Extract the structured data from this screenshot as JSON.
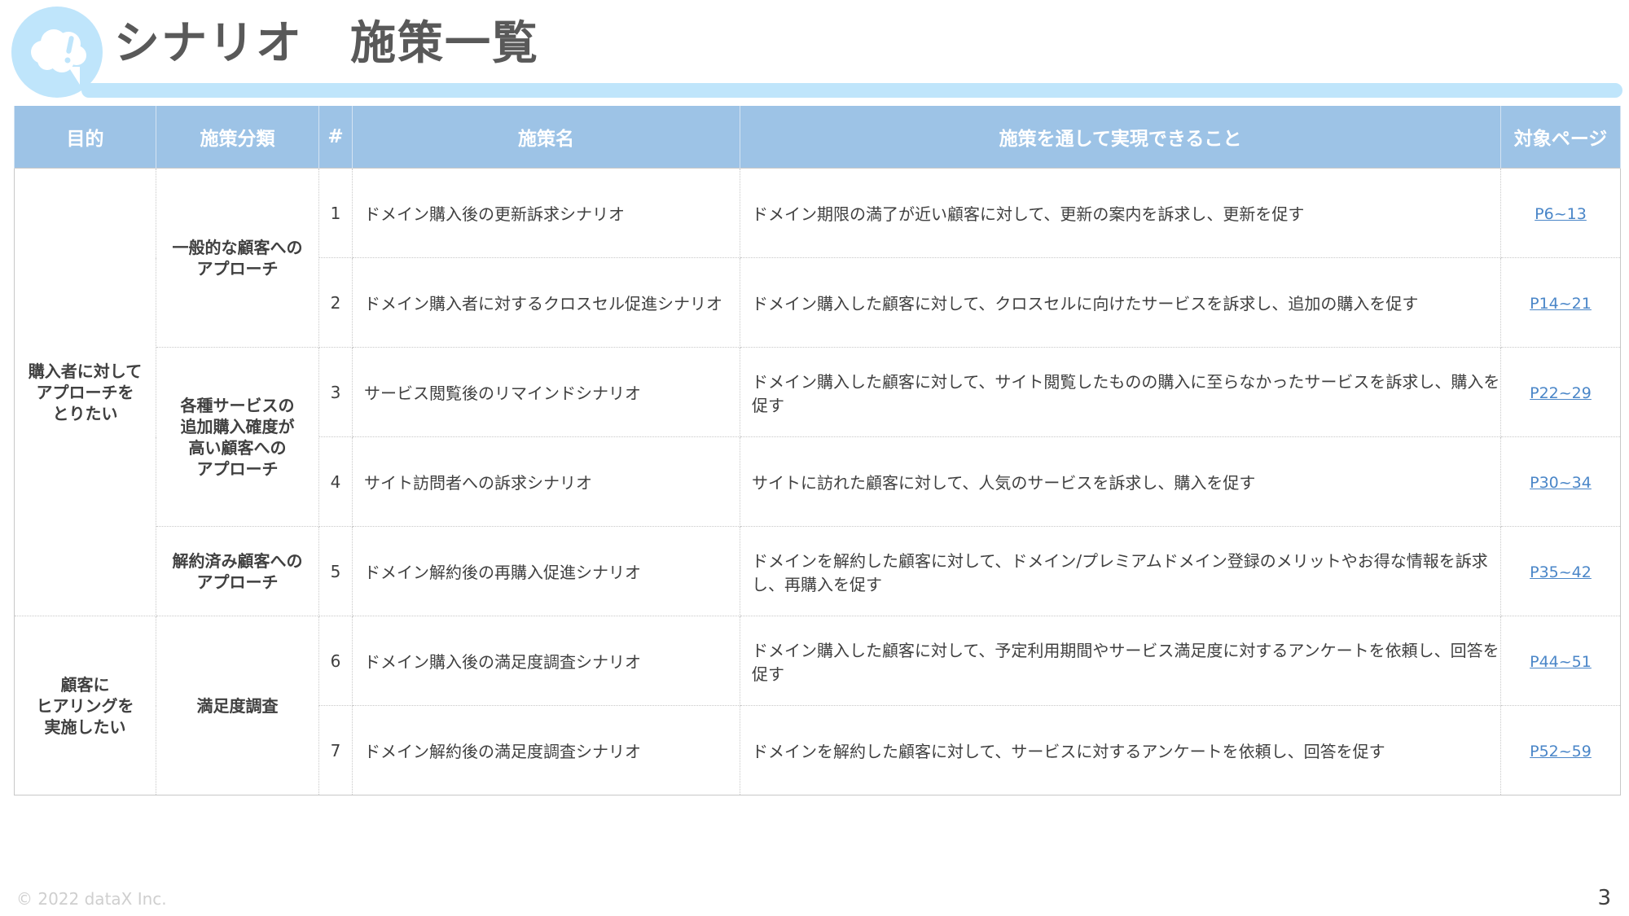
{
  "header": {
    "title": "シナリオ　施策一覧",
    "logo_icon": "thought-bubble-exclamation-icon",
    "accent_color": "#bfe5fb"
  },
  "table": {
    "header_color": "#9dc3e6",
    "link_color": "#4a86c8",
    "columns": [
      "目的",
      "施策分類",
      "#",
      "施策名",
      "施策を通して実現できること",
      "対象ページ"
    ],
    "purposes": [
      {
        "label": "購入者に対して\nアプローチを\nとりたい",
        "rows": 5
      },
      {
        "label": "顧客に\nヒアリングを\n実施したい",
        "rows": 2
      }
    ],
    "categories": [
      {
        "label": "一般的な顧客への\nアプローチ",
        "rows": 2
      },
      {
        "label": "各種サービスの\n追加購入確度が\n高い顧客への\nアプローチ",
        "rows": 2
      },
      {
        "label": "解約済み顧客への\nアプローチ",
        "rows": 1
      },
      {
        "label": "満足度調査",
        "rows": 2
      }
    ],
    "rows": [
      {
        "num": "1",
        "name": "ドメイン購入後の更新訴求シナリオ",
        "desc": "ドメイン期限の満了が近い顧客に対して、更新の案内を訴求し、更新を促す",
        "page": "P6~13"
      },
      {
        "num": "2",
        "name": "ドメイン購入者に対するクロスセル促進シナリオ",
        "desc": "ドメイン購入した顧客に対して、クロスセルに向けたサービスを訴求し、追加の購入を促す",
        "page": "P14~21"
      },
      {
        "num": "3",
        "name": "サービス閲覧後のリマインドシナリオ",
        "desc": "ドメイン購入した顧客に対して、サイト閲覧したものの購入に至らなかったサービスを訴求し、購入を促す",
        "page": "P22~29"
      },
      {
        "num": "4",
        "name": "サイト訪問者への訴求シナリオ",
        "desc": "サイトに訪れた顧客に対して、人気のサービスを訴求し、購入を促す",
        "page": "P30~34"
      },
      {
        "num": "5",
        "name": "ドメイン解約後の再購入促進シナリオ",
        "desc": "ドメインを解約した顧客に対して、ドメイン/プレミアムドメイン登録のメリットやお得な情報を訴求し、再購入を促す",
        "page": "P35~42"
      },
      {
        "num": "6",
        "name": "ドメイン購入後の満足度調査シナリオ",
        "desc": "ドメイン購入した顧客に対して、予定利用期間やサービス満足度に対するアンケートを依頼し、回答を促す",
        "page": "P44~51"
      },
      {
        "num": "7",
        "name": "ドメイン解約後の満足度調査シナリオ",
        "desc": "ドメインを解約した顧客に対して、サービスに対するアンケートを依頼し、回答を促す",
        "page": "P52~59"
      }
    ]
  },
  "footer": {
    "copyright": "© 2022 dataX Inc.",
    "page_number": "3"
  }
}
